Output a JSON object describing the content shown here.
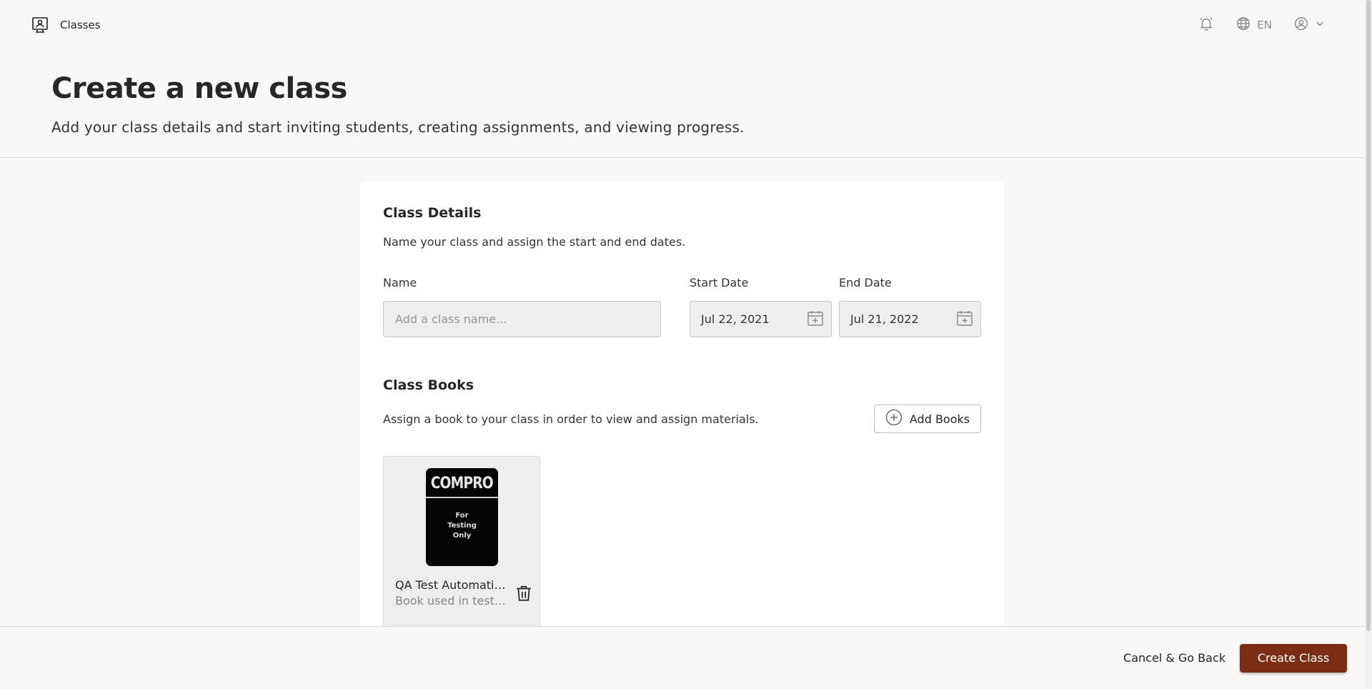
{
  "topbar": {
    "brand_label": "Classes",
    "language": "EN"
  },
  "header": {
    "title": "Create a new class",
    "subtitle": "Add your class details and start inviting students, creating assignments, and viewing progress."
  },
  "class_details": {
    "title": "Class Details",
    "description": "Name your class and assign the start and end dates.",
    "name_label": "Name",
    "name_placeholder": "Add a class name...",
    "name_value": "",
    "start_label": "Start Date",
    "start_value": "Jul 22, 2021",
    "end_label": "End Date",
    "end_value": "Jul 21, 2022"
  },
  "class_books": {
    "title": "Class Books",
    "description": "Assign a book to your class in order to view and assign materials.",
    "add_button": "Add Books",
    "books": [
      {
        "cover_brand": "COMPRO",
        "cover_tag": "For\nTesting\nOnly",
        "title": "QA Test Automation",
        "subtitle": "Book used in testing"
      }
    ]
  },
  "footer": {
    "cancel": "Cancel & Go Back",
    "create": "Create Class"
  },
  "colors": {
    "background": "#f9f8f7",
    "primary_button": "#7a2e14",
    "input_bg": "#efeeed"
  },
  "icons": [
    "classroom-icon",
    "bell-icon",
    "globe-icon",
    "user-circle-icon",
    "chevron-down-icon",
    "calendar-icon",
    "plus-circle-icon",
    "trash-icon"
  ]
}
